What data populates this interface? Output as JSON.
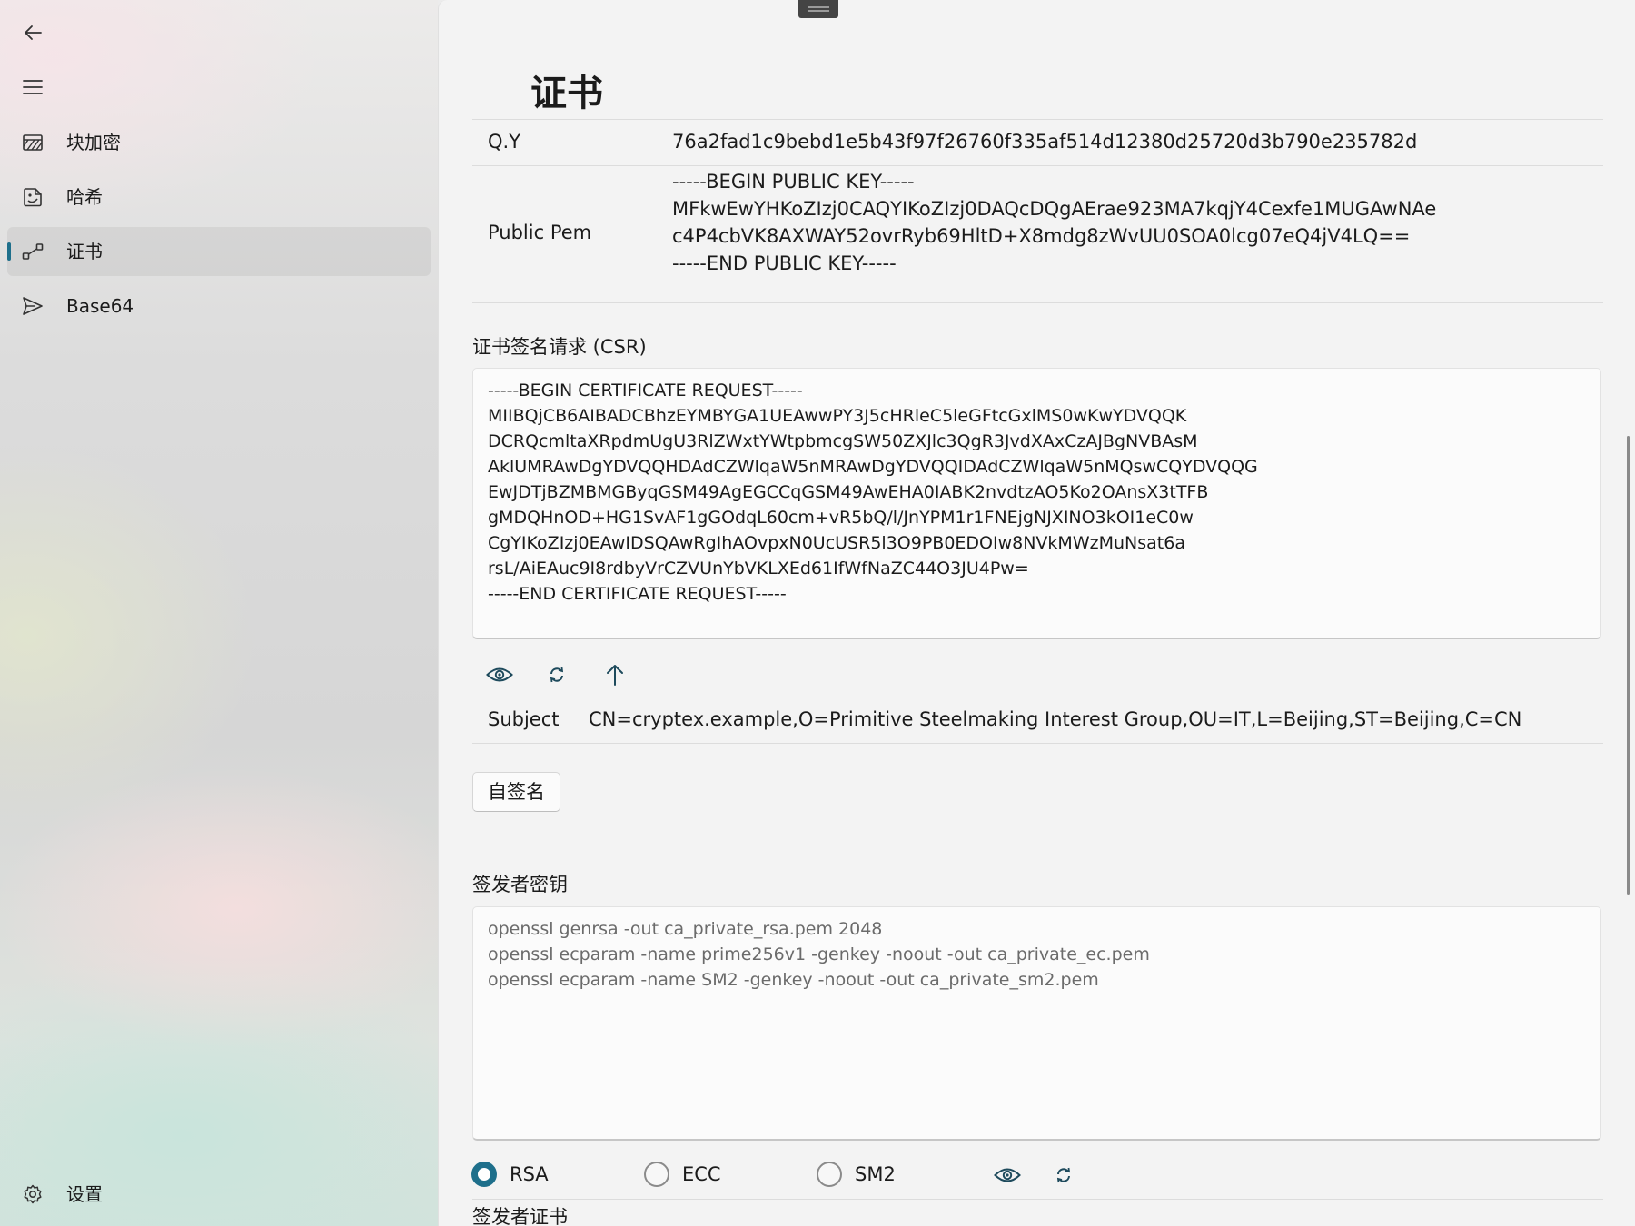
{
  "sidebar": {
    "items": [
      {
        "label": "块加密",
        "icon": "block-cipher-icon"
      },
      {
        "label": "哈希",
        "icon": "hash-icon"
      },
      {
        "label": "证书",
        "icon": "certificate-icon",
        "selected": true
      },
      {
        "label": "Base64",
        "icon": "send-icon"
      }
    ],
    "settings_label": "设置",
    "accent_color": "#1e6f8b"
  },
  "page": {
    "title": "证书",
    "qy_label": "Q.Y",
    "qy_value": "76a2fad1c9bebd1e5b43f97f26760f335af514d12380d25720d3b790e235782d",
    "public_pem_label": "Public Pem",
    "public_pem_value": "-----BEGIN PUBLIC KEY-----\nMFkwEwYHKoZIzj0CAQYIKoZIzj0DAQcDQgAErae923MA7kqjY4Cexfe1MUGAwNAe\nc4P4cbVK8AXWAY52ovrRyb69HltD+X8mdg8zWvUU0SOA0lcg07eQ4jV4LQ==\n-----END PUBLIC KEY-----",
    "csr_label": "证书签名请求 (CSR)",
    "csr_value": "-----BEGIN CERTIFICATE REQUEST-----\nMIIBQjCB6AIBADCBhzEYMBYGA1UEAwwPY3J5cHRleC5leGFtcGxlMS0wKwYDVQQK\nDCRQcmltaXRpdmUgU3RlZWxtYWtpbmcgSW50ZXJlc3QgR3JvdXAxCzAJBgNVBAsM\nAklUMRAwDgYDVQQHDAdCZWlqaW5nMRAwDgYDVQQIDAdCZWlqaW5nMQswCQYDVQQG\nEwJDTjBZMBMGByqGSM49AgEGCCqGSM49AwEHA0IABK2nvdtzAO5Ko2OAnsX3tTFB\ngMDQHnOD+HG1SvAF1gGOdqL60cm+vR5bQ/l/JnYPM1r1FNEjgNJXINO3kOI1eC0w\nCgYIKoZIzj0EAwIDSQAwRgIhAOvpxN0UcUSR5l3O9PB0EDOIw8NVkMWzMuNsat6a\nrsL/AiEAuc9I8rdbyVrCZVUnYbVKLXEd61IfWfNaZC44O3JU4Pw=\n-----END CERTIFICATE REQUEST-----",
    "subject_label": "Subject",
    "subject_value": "CN=cryptex.example,O=Primitive Steelmaking Interest Group,OU=IT,L=Beijing,ST=Beijing,C=CN",
    "self_sign_label": "自签名",
    "issuer_key_label": "签发者密钥",
    "issuer_key_placeholder": "openssl genrsa -out ca_private_rsa.pem 2048\nopenssl ecparam -name prime256v1 -genkey -noout -out ca_private_ec.pem\nopenssl ecparam -name SM2 -genkey -noout -out ca_private_sm2.pem",
    "key_types": [
      {
        "label": "RSA",
        "checked": true
      },
      {
        "label": "ECC",
        "checked": false
      },
      {
        "label": "SM2",
        "checked": false
      }
    ],
    "issuer_cert_label": "签发者证书"
  }
}
